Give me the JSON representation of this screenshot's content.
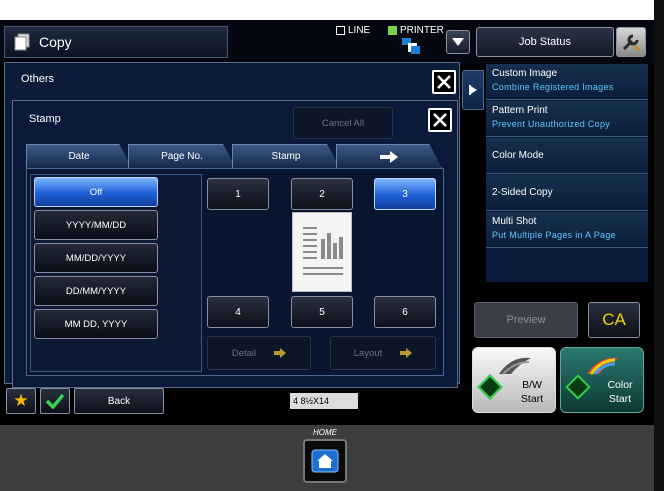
{
  "header": {
    "title": "Copy",
    "line_label": "LINE",
    "printer_label": "PRINTER",
    "job_status": "Job Status"
  },
  "others_dialog": {
    "title": "Others"
  },
  "stamp_dialog": {
    "title": "Stamp",
    "cancel_all": "Cancel All",
    "tabs": [
      "Date",
      "Page No.",
      "Stamp"
    ],
    "format_options": [
      "Off",
      "YYYY/MM/DD",
      "MM/DD/YYYY",
      "DD/MM/YYYY",
      "MM DD, YYYY"
    ],
    "selected_format": "Off",
    "positions": [
      "1",
      "2",
      "3",
      "4",
      "5",
      "6"
    ],
    "selected_position": "3",
    "detail": "Detail",
    "layout": "Layout"
  },
  "right_panel": {
    "items": [
      {
        "label": "Custom Image",
        "sub": "Combine Registered Images"
      },
      {
        "label": "Pattern Print",
        "sub": "Prevent Unauthorized Copy"
      },
      {
        "label": "Color Mode",
        "sub": ""
      },
      {
        "label": "2-Sided Copy",
        "sub": ""
      },
      {
        "label": "Multi Shot",
        "sub": "Put Multiple Pages in A Page"
      }
    ]
  },
  "preview": "Preview",
  "ca": "CA",
  "bw_start": {
    "line1": "B/W",
    "line2": "Start"
  },
  "color_start": {
    "line1": "Color",
    "line2": "Start"
  },
  "back": "Back",
  "paper_indicator": "4  8½X14",
  "home_label": "HOME",
  "colors": {
    "accent_blue": "#1d5ed6",
    "panel_navy": "#0b1a38",
    "sub_cyan": "#5ec8ff",
    "ca_yellow": "#f0d000",
    "start_green": "#2fd04a"
  }
}
